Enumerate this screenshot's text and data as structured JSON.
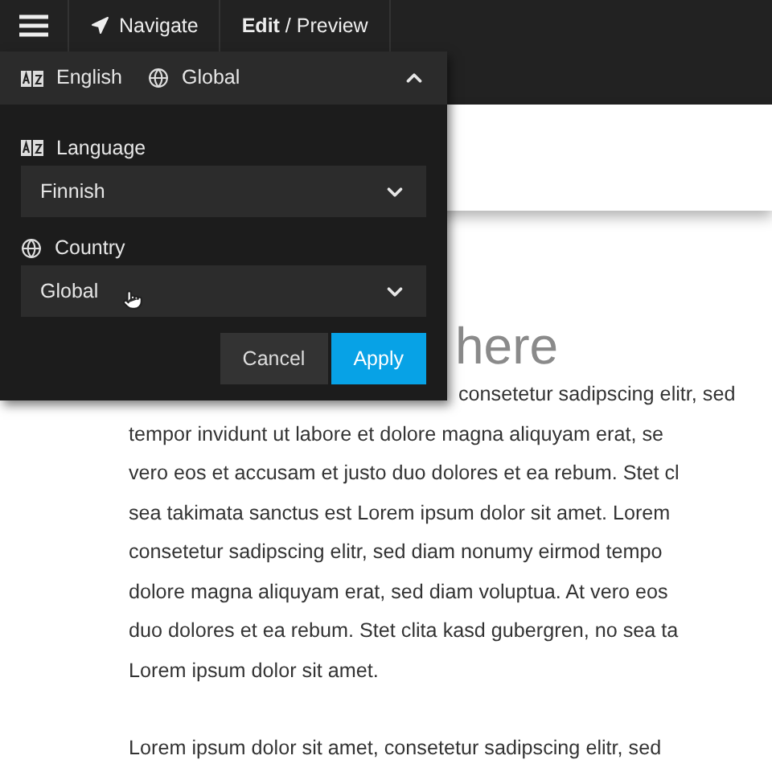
{
  "top_bar": {
    "items": [
      "Navigate",
      "**Edit** / Preview"
    ]
  },
  "locale_bar": {
    "language": "English",
    "country": "Global",
    "expanded": true
  },
  "popover": {
    "fields": [
      {
        "kind": "language",
        "label": "Language",
        "value": "Finnish"
      },
      {
        "kind": "country",
        "label": "Country",
        "value": "Global"
      }
    ],
    "buttons": [
      {
        "kind": "secondary",
        "label": "Cancel"
      },
      {
        "kind": "primary",
        "label": "Apply"
      }
    ]
  },
  "page": {
    "heading": "here",
    "paragraphs": [
      [
        "consetetur sadipscing elitr, sed",
        "tempor invidunt ut labore et dolore magna aliquyam erat, se",
        "vero eos et accusam et justo duo dolores et ea rebum. Stet cl",
        "sea takimata sanctus est Lorem ipsum dolor sit amet. Lorem",
        "consetetur sadipscing elitr, sed diam nonumy eirmod tempo",
        "dolore magna aliquyam erat, sed diam voluptua. At vero eos",
        "duo dolores et ea rebum. Stet clita kasd gubergren, no sea ta",
        "Lorem ipsum dolor sit amet."
      ],
      [
        "Lorem ipsum dolor sit amet, consetetur sadipscing elitr, sed"
      ]
    ]
  }
}
